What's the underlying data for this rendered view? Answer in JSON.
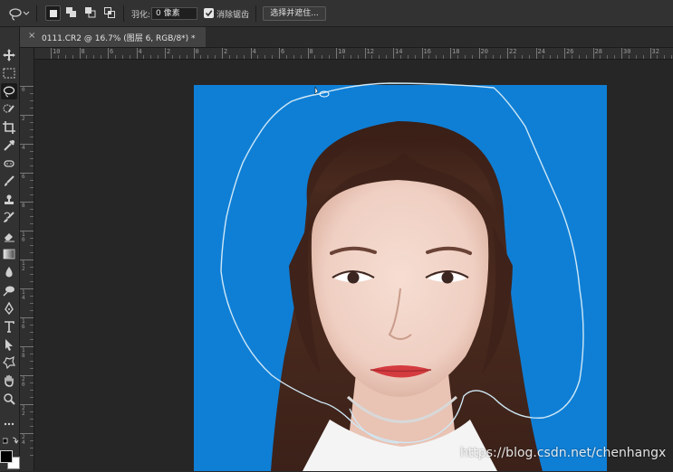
{
  "options_bar": {
    "tool_icon": "lasso-icon",
    "feather_label": "羽化:",
    "feather_value": "0 像素",
    "antialias_label": "消除锯齿",
    "antialias_checked": true,
    "select_and_mask_label": "选择并遮住..."
  },
  "document_tab": {
    "close_glyph": "×",
    "title": "0111.CR2 @ 16.7% (图层 6, RGB/8*) *"
  },
  "ruler": {
    "h_labels": [
      "10",
      "8",
      "6",
      "4",
      "2",
      "0",
      "2",
      "4",
      "6",
      "8",
      "10",
      "12",
      "14",
      "16",
      "18",
      "20",
      "22",
      "24",
      "26",
      "28",
      "30",
      "32"
    ],
    "v_labels": [
      "0",
      "2",
      "4",
      "6",
      "8",
      "1\n0",
      "1\n2",
      "1\n4",
      "1\n6",
      "1\n8",
      "2\n0",
      "2\n2",
      "2\n4"
    ]
  },
  "tools": [
    "move-icon",
    "marquee-icon",
    "lasso-icon",
    "quick-selection-icon",
    "crop-icon",
    "eyedropper-icon",
    "spot-healing-icon",
    "brush-icon",
    "clone-stamp-icon",
    "history-brush-icon",
    "eraser-icon",
    "gradient-icon",
    "blur-icon",
    "dodge-icon",
    "pen-icon",
    "type-icon",
    "path-selection-icon",
    "custom-shape-icon",
    "hand-icon",
    "zoom-icon",
    "more-tools-icon"
  ],
  "colors": {
    "photo_background": "#0f7fd6",
    "foreground_swatch": "#000000",
    "background_swatch": "#ffffff",
    "selection_path": "#cfe8f5"
  },
  "watermark": "https://blog.csdn.net/chenhangx"
}
